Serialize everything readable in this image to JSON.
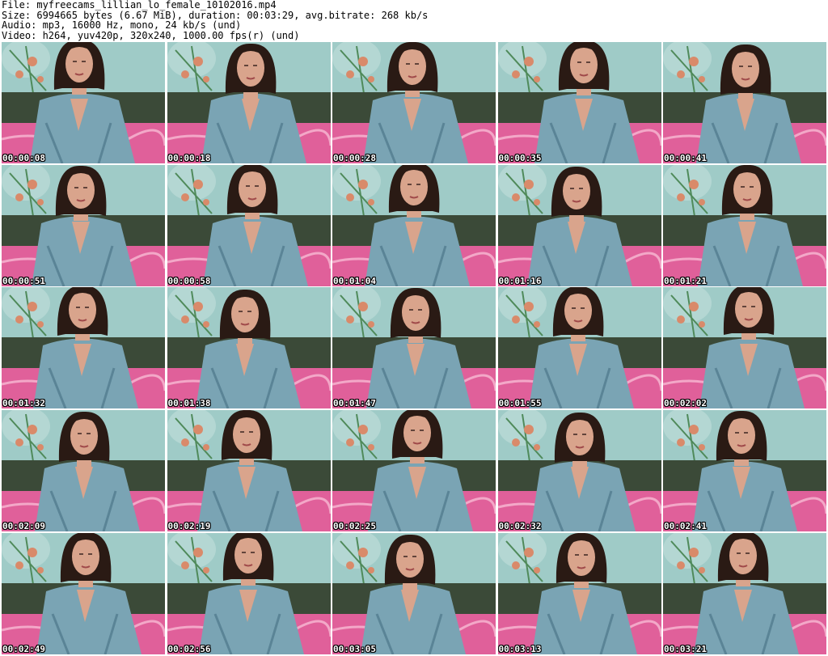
{
  "header": {
    "file_line": "File: myfreecams_lillian_lo_female_10102016.mp4",
    "size_line": "Size: 6994665 bytes (6.67 MiB), duration: 00:03:29, avg.bitrate: 268 kb/s",
    "audio_line": "Audio: mp3, 16000 Hz, mono, 24 kb/s (und)",
    "video_line": "Video: h264, yuv420p, 320x240, 1000.00 fps(r) (und)"
  },
  "thumbnails": [
    {
      "timestamp": "00:00:08"
    },
    {
      "timestamp": "00:00:18"
    },
    {
      "timestamp": "00:00:28"
    },
    {
      "timestamp": "00:00:35"
    },
    {
      "timestamp": "00:00:41"
    },
    {
      "timestamp": "00:00:51"
    },
    {
      "timestamp": "00:00:58"
    },
    {
      "timestamp": "00:01:04"
    },
    {
      "timestamp": "00:01:16"
    },
    {
      "timestamp": "00:01:21"
    },
    {
      "timestamp": "00:01:32"
    },
    {
      "timestamp": "00:01:38"
    },
    {
      "timestamp": "00:01:47"
    },
    {
      "timestamp": "00:01:55"
    },
    {
      "timestamp": "00:02:02"
    },
    {
      "timestamp": "00:02:09"
    },
    {
      "timestamp": "00:02:19"
    },
    {
      "timestamp": "00:02:25"
    },
    {
      "timestamp": "00:02:32"
    },
    {
      "timestamp": "00:02:41"
    },
    {
      "timestamp": "00:02:49"
    },
    {
      "timestamp": "00:02:56"
    },
    {
      "timestamp": "00:03:05"
    },
    {
      "timestamp": "00:03:13"
    },
    {
      "timestamp": "00:03:21"
    }
  ],
  "colors": {
    "wall": "#9fcbc7",
    "shirt": "#7aa4b4",
    "shirt_shadow": "#5a8496",
    "hair": "#2a1a14",
    "skin": "#d9a48c",
    "sofa": "#3b4a38",
    "blanket": "#e0609a",
    "flower": "#d98a6a",
    "timestamp_text": "#ffffff"
  }
}
